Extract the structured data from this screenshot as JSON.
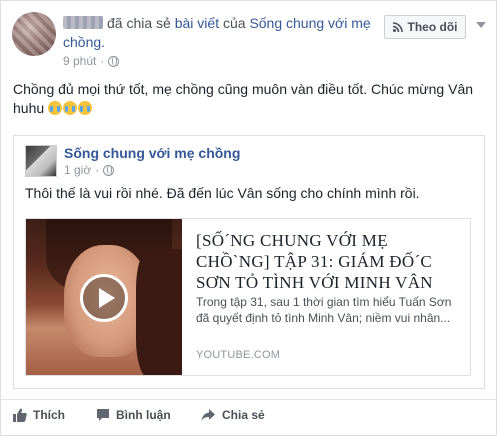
{
  "header": {
    "action_text": "đã chia sẻ",
    "object_link": "bài viết",
    "of_text": "của",
    "page_link": "Sống chung với mẹ chồng.",
    "time": "9 phút",
    "follow_label": "Theo dõi"
  },
  "post": {
    "text": "Chồng đủ mọi thứ tốt, mẹ chồng cũng muôn vàn điều tốt. Chúc mừng Vân huhu"
  },
  "shared": {
    "page_name": "Sống chung với mẹ chồng",
    "time": "1 giờ",
    "text": "Thôi thế là vui rồi nhé. Đã đến lúc Vân sống cho chính mình rồi.",
    "link": {
      "title": "[SỐ´NG CHUNG VỚI MẸ CHỒ`NG] TẬP 31: GIÁM ĐỐ´C SƠN TỎ TÌNH VỚI MINH VÂN",
      "description": "Trong tập 31, sau 1 thời gian tìm hiểu Tuấn Sơn đã quyết định tỏ tình Minh Vân; niềm vui nhân...",
      "domain": "YOUTUBE.COM"
    }
  },
  "actions": {
    "like": "Thích",
    "comment": "Bình luận",
    "share": "Chia sẻ"
  },
  "colors": {
    "link": "#365899",
    "text": "#1d2129",
    "muted": "#90949c",
    "border": "#dddfe2"
  },
  "icons": [
    "globe-icon",
    "rss-icon",
    "play-icon",
    "like-icon",
    "comment-icon",
    "share-icon",
    "chevron-down-icon"
  ]
}
